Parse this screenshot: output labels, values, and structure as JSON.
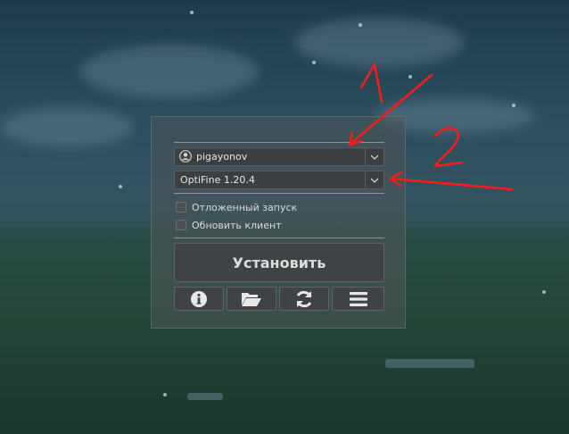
{
  "account": {
    "username": "pigayonov"
  },
  "version": {
    "selected": "OptiFine 1.20.4"
  },
  "options": [
    {
      "label": "Отложенный запуск",
      "checked": false
    },
    {
      "label": "Обновить клиент",
      "checked": false
    }
  ],
  "actions": {
    "install_label": "Установить"
  },
  "toolbar": {
    "icons": [
      "info-icon",
      "folder-open-icon",
      "refresh-icon",
      "menu-icon"
    ]
  },
  "annotations": {
    "label_1": "1",
    "label_2": "2",
    "color": "#ff1a1a"
  },
  "colors": {
    "panel": "#4e5658",
    "button": "#404345",
    "text": "#dcdcdc"
  }
}
